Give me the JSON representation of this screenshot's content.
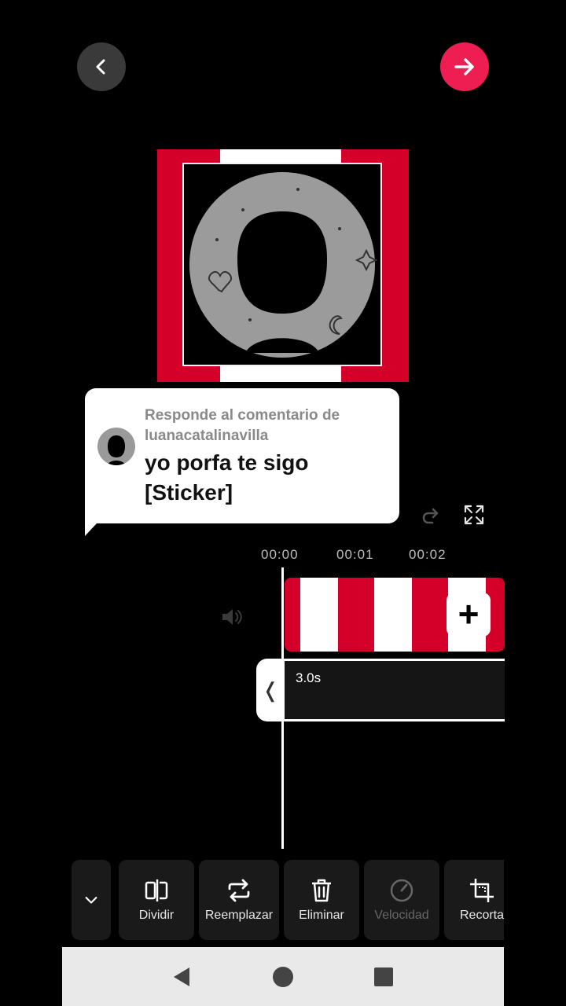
{
  "reply": {
    "header": "Responde al comentario de luanacatalinavilla",
    "comment": "yo porfa te sigo [Sticker]"
  },
  "timeline": {
    "ticks": [
      "00:00",
      "00:01",
      "00:02"
    ],
    "text_track_duration": "3.0s"
  },
  "toolbar": {
    "split": "Dividir",
    "replace": "Reemplazar",
    "delete": "Eliminar",
    "speed": "Velocidad",
    "crop": "Recorta"
  },
  "colors": {
    "accent": "#ee1d52",
    "stripe_red": "#d4002a",
    "stripe_white": "#ffffff"
  },
  "icons": {
    "back": "chevron-left-icon",
    "next": "arrow-right-icon",
    "redo": "redo-icon",
    "fullscreen": "fullscreen-icon",
    "sound": "speaker-icon",
    "collapse": "chevron-down-icon",
    "add": "plus-icon"
  }
}
